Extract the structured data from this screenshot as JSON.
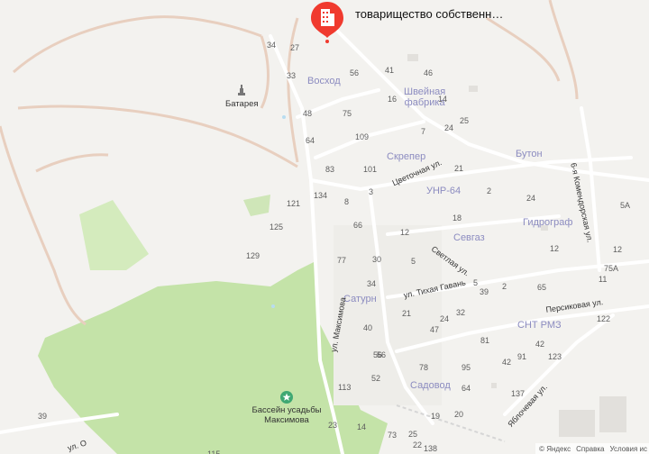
{
  "pin": {
    "label": "товарищество собственн…",
    "icon": "building-icon",
    "color": "#f03a2e"
  },
  "pois": [
    {
      "id": "battery",
      "label": "Батарея",
      "icon": "monument-icon"
    },
    {
      "id": "pool",
      "label": "Бассейн усадьбы\nМаксимова",
      "icon": "star-icon"
    }
  ],
  "districts": [
    {
      "id": "voshod",
      "label": "Восход"
    },
    {
      "id": "shveynaya",
      "label": "Швейная\nфабрика"
    },
    {
      "id": "skreper",
      "label": "Скрепер"
    },
    {
      "id": "buton",
      "label": "Бутон"
    },
    {
      "id": "unr64",
      "label": "УНР-64"
    },
    {
      "id": "sevgaz",
      "label": "Севгаз"
    },
    {
      "id": "gidrograf",
      "label": "Гидрограф"
    },
    {
      "id": "saturn",
      "label": "Сатурн"
    },
    {
      "id": "snt_rmz",
      "label": "СНТ РМЗ"
    },
    {
      "id": "sadovod",
      "label": "Садовод"
    }
  ],
  "streets": [
    {
      "id": "cvetochnaya",
      "label": "Цветочная ул."
    },
    {
      "id": "komendorskaya",
      "label": "6-я Комендорская ул."
    },
    {
      "id": "svetlaya",
      "label": "Светлая ул."
    },
    {
      "id": "tihaya_gavan",
      "label": "ул. Тихая Гавань"
    },
    {
      "id": "maksimova",
      "label": "ул. Максимова"
    },
    {
      "id": "persikovaya",
      "label": "Персиковая ул."
    },
    {
      "id": "yablochevaya",
      "label": "Яблочевая ул."
    },
    {
      "id": "ul_o",
      "label": "ул. О"
    }
  ],
  "house_numbers": [
    "34",
    "27",
    "33",
    "56",
    "41",
    "46",
    "16",
    "14",
    "75",
    "48",
    "64",
    "109",
    "25",
    "7",
    "24",
    "83",
    "101",
    "21",
    "134",
    "3",
    "2",
    "8",
    "121",
    "66",
    "18",
    "125",
    "12",
    "5",
    "129",
    "77",
    "30",
    "34",
    "5",
    "39",
    "2",
    "12",
    "24",
    "5A",
    "12",
    "65",
    "11",
    "75A",
    "122",
    "42",
    "21",
    "24",
    "32",
    "56",
    "47",
    "81",
    "42",
    "40",
    "56",
    "91",
    "123",
    "78",
    "95",
    "113",
    "52",
    "64",
    "137",
    "20",
    "19",
    "39",
    "115",
    "73",
    "25",
    "22",
    "14",
    "23",
    "138"
  ],
  "footer": {
    "copyright": "© Яндекс",
    "help": "Справка",
    "terms": "Условия ис"
  }
}
